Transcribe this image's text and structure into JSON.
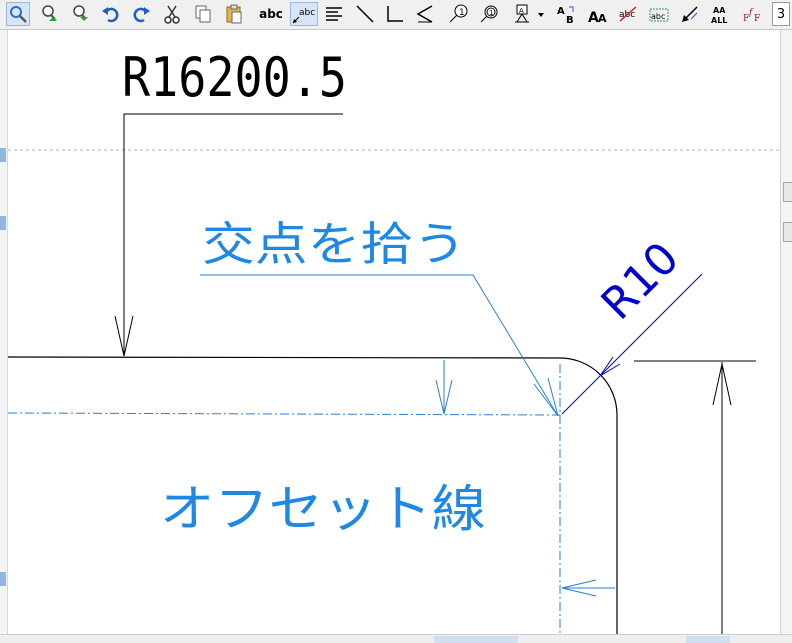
{
  "toolbar": {
    "buttons": [
      {
        "name": "zoom-window-icon"
      },
      {
        "name": "zoom-in-icon"
      },
      {
        "name": "zoom-out-icon"
      },
      {
        "name": "undo-icon"
      },
      {
        "name": "redo-icon"
      },
      {
        "name": "cut-icon"
      },
      {
        "name": "copy-icon"
      },
      {
        "name": "paste-icon"
      },
      {
        "name": "text-icon",
        "label": "abc"
      },
      {
        "name": "leader-text-icon",
        "label": "abc"
      },
      {
        "name": "align-left-icon"
      },
      {
        "name": "line-icon"
      },
      {
        "name": "corner-icon"
      },
      {
        "name": "angle-icon"
      },
      {
        "name": "balloon-icon"
      },
      {
        "name": "balloon-number-icon"
      },
      {
        "name": "attribute-icon"
      },
      {
        "name": "text-replace-icon"
      },
      {
        "name": "font-size-icon"
      },
      {
        "name": "text-delete-icon"
      },
      {
        "name": "text-select-icon",
        "label": "abc"
      },
      {
        "name": "arrow-point-icon"
      },
      {
        "name": "all-text-icon",
        "label": "ALL"
      },
      {
        "name": "font-style-icon"
      }
    ],
    "overflow_label": "3"
  },
  "drawing": {
    "dimension_radius_large": "R16200.5",
    "annotation_intersection": "交点を拾う",
    "dimension_radius_small": "R10",
    "annotation_offset": "オフセット線"
  },
  "colors": {
    "toolbar_bg": "#f0f0f0",
    "cad_line": "#000000",
    "annotation_blue": "#1e88e5",
    "dimension_blue": "#0000cc",
    "offset_line": "#2a7fd4",
    "guide_line": "#8aa0b6"
  }
}
